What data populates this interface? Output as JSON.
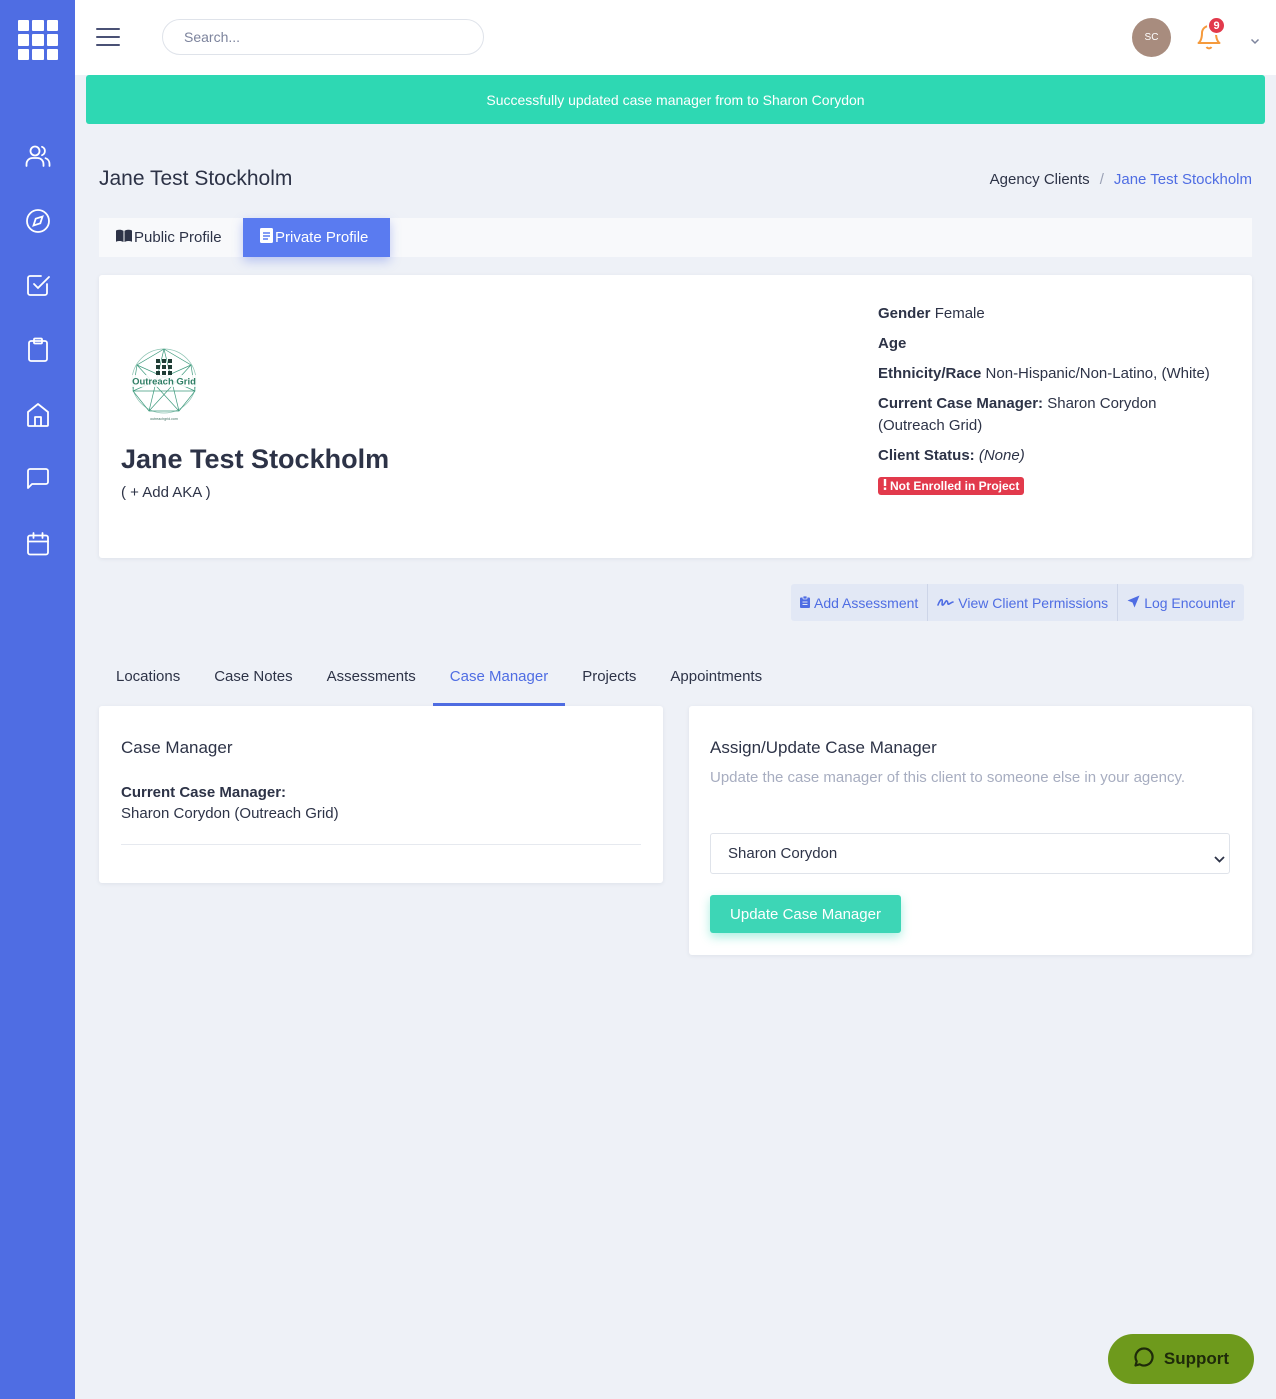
{
  "sidebar": {
    "icons": [
      "users-icon",
      "compass-icon",
      "checkbox-icon",
      "clipboard-icon",
      "home-icon",
      "chat-icon",
      "calendar-icon"
    ]
  },
  "topbar": {
    "search_placeholder": "Search...",
    "avatar_initials": "SC",
    "notification_count": "9"
  },
  "alert": {
    "message": "Successfully updated case manager from to Sharon Corydon"
  },
  "header": {
    "title": "Jane Test Stockholm",
    "breadcrumb": [
      "Agency Clients",
      "/",
      "Jane Test Stockholm"
    ]
  },
  "profile_tabs": {
    "public": "Public Profile",
    "private": "Private Profile"
  },
  "profile": {
    "org_logo_text": "Outreach Grid",
    "org_logo_url_text": "outreachgrid.com",
    "name": "Jane Test Stockholm",
    "aka": "( + Add AKA )",
    "gender_label": "Gender",
    "gender_value": "Female",
    "age_label": "Age",
    "ethnicity_label": "Ethnicity/Race",
    "ethnicity_value": "Non-Hispanic/Non-Latino, (White)",
    "case_manager_label": "Current Case Manager:",
    "case_manager_value": "Sharon Corydon (Outreach Grid)",
    "status_label": "Client Status:",
    "status_value": "(None)",
    "enrollment_badge": "Not Enrolled in Project",
    "badge_color": "#e23a4c"
  },
  "actions": {
    "add_assessment": "Add Assessment",
    "view_permissions": "View Client Permissions",
    "log_encounter": "Log Encounter"
  },
  "main_tabs": [
    "Locations",
    "Case Notes",
    "Assessments",
    "Case Manager",
    "Projects",
    "Appointments"
  ],
  "case_manager": {
    "title": "Case Manager",
    "current_label": "Current Case Manager:",
    "current_value": "Sharon Corydon (Outreach Grid)"
  },
  "assign": {
    "title": "Assign/Update Case Manager",
    "description": "Update the case manager of this client to someone else in your agency.",
    "selected": "Sharon Corydon",
    "button": "Update Case Manager"
  },
  "support": {
    "label": "Support"
  },
  "colors": {
    "sidebar": "#4f6de3",
    "accent": "#4f6de3",
    "success": "#2ed8b3",
    "support": "#6e9a1c"
  }
}
